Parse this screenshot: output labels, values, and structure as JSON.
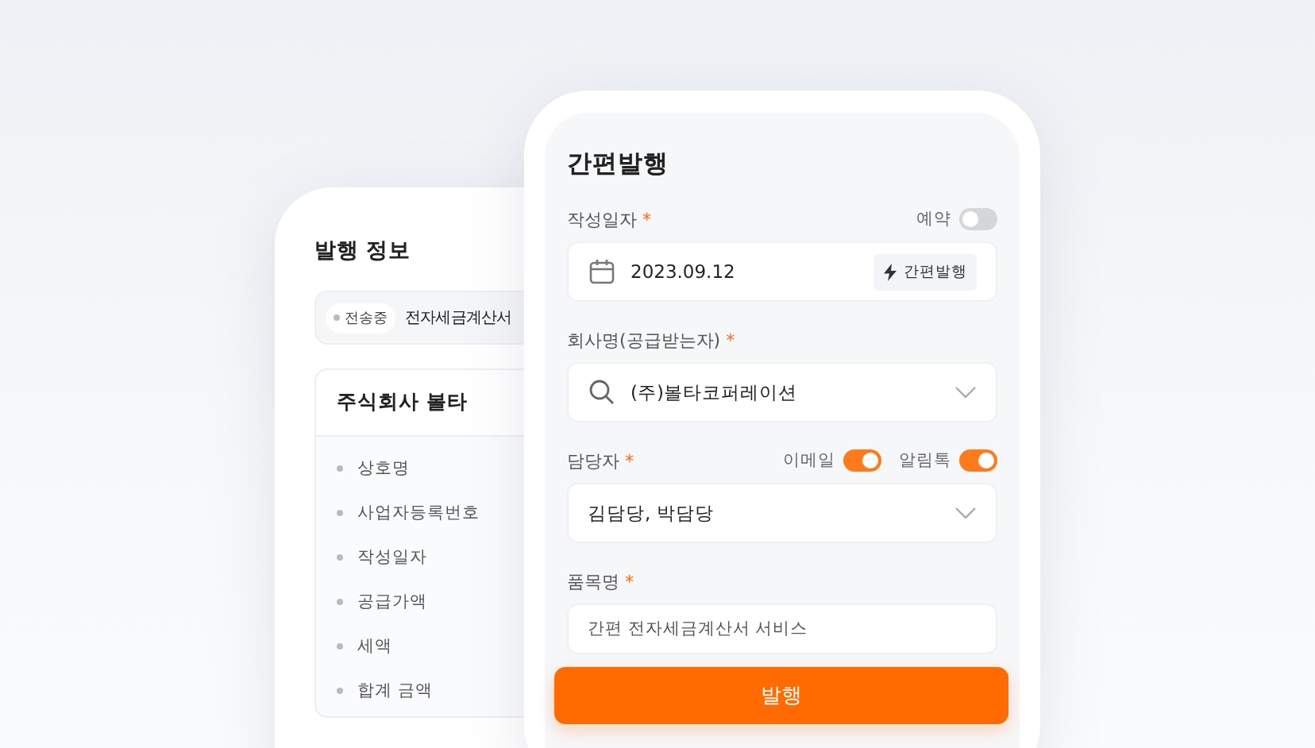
{
  "back_panel": {
    "title": "발행 정보",
    "status": {
      "label": "전송중",
      "text": "전자세금계산서"
    },
    "card": {
      "title": "주식회사 볼타",
      "items": [
        "상호명",
        "사업자등록번호",
        "작성일자",
        "공급가액",
        "세액",
        "합계 금액"
      ]
    }
  },
  "form": {
    "title": "간편발행",
    "fields": [
      {
        "kind": "date",
        "label": "작성일자",
        "required_mark": "*",
        "toggles": [
          {
            "label": "예약",
            "on": false
          }
        ],
        "value": "2023.09.12",
        "action": "간편발행"
      },
      {
        "kind": "search",
        "label": "회사명(공급받는자)",
        "required_mark": "*",
        "value": "(주)볼타코퍼레이션"
      },
      {
        "kind": "select",
        "label": "담당자",
        "required_mark": "*",
        "toggles": [
          {
            "label": "이메일",
            "on": true
          },
          {
            "label": "알림톡",
            "on": true
          }
        ],
        "value": "김담당, 박담당"
      },
      {
        "kind": "text",
        "label": "품목명",
        "required_mark": "*",
        "value": "간편 전자세금계산서 서비스"
      }
    ],
    "submit": "발행"
  }
}
